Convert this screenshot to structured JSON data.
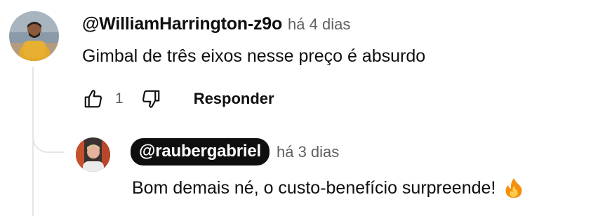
{
  "comment": {
    "author": "@WilliamHarrington-z9o",
    "time": "há 4 dias",
    "text": "Gimbal de três eixos nesse preço é absurdo",
    "like_count": "1",
    "reply_label": "Responder",
    "avatar_icon": "user-avatar-photo"
  },
  "reply": {
    "author": "@raubergabriel",
    "time": "há 3 dias",
    "text": "Bom demais né, o custo-benefício surpreende!",
    "emoji_icon": "fire-emoji",
    "avatar_icon": "user-avatar-photo"
  },
  "icons": {
    "like": "thumbs-up-icon",
    "dislike": "thumbs-down-icon"
  },
  "colors": {
    "primary_text": "#0f0f0f",
    "secondary_text": "#606060",
    "thread_line": "#e5e5e5",
    "author_chip_bg": "#0f0f0f"
  }
}
